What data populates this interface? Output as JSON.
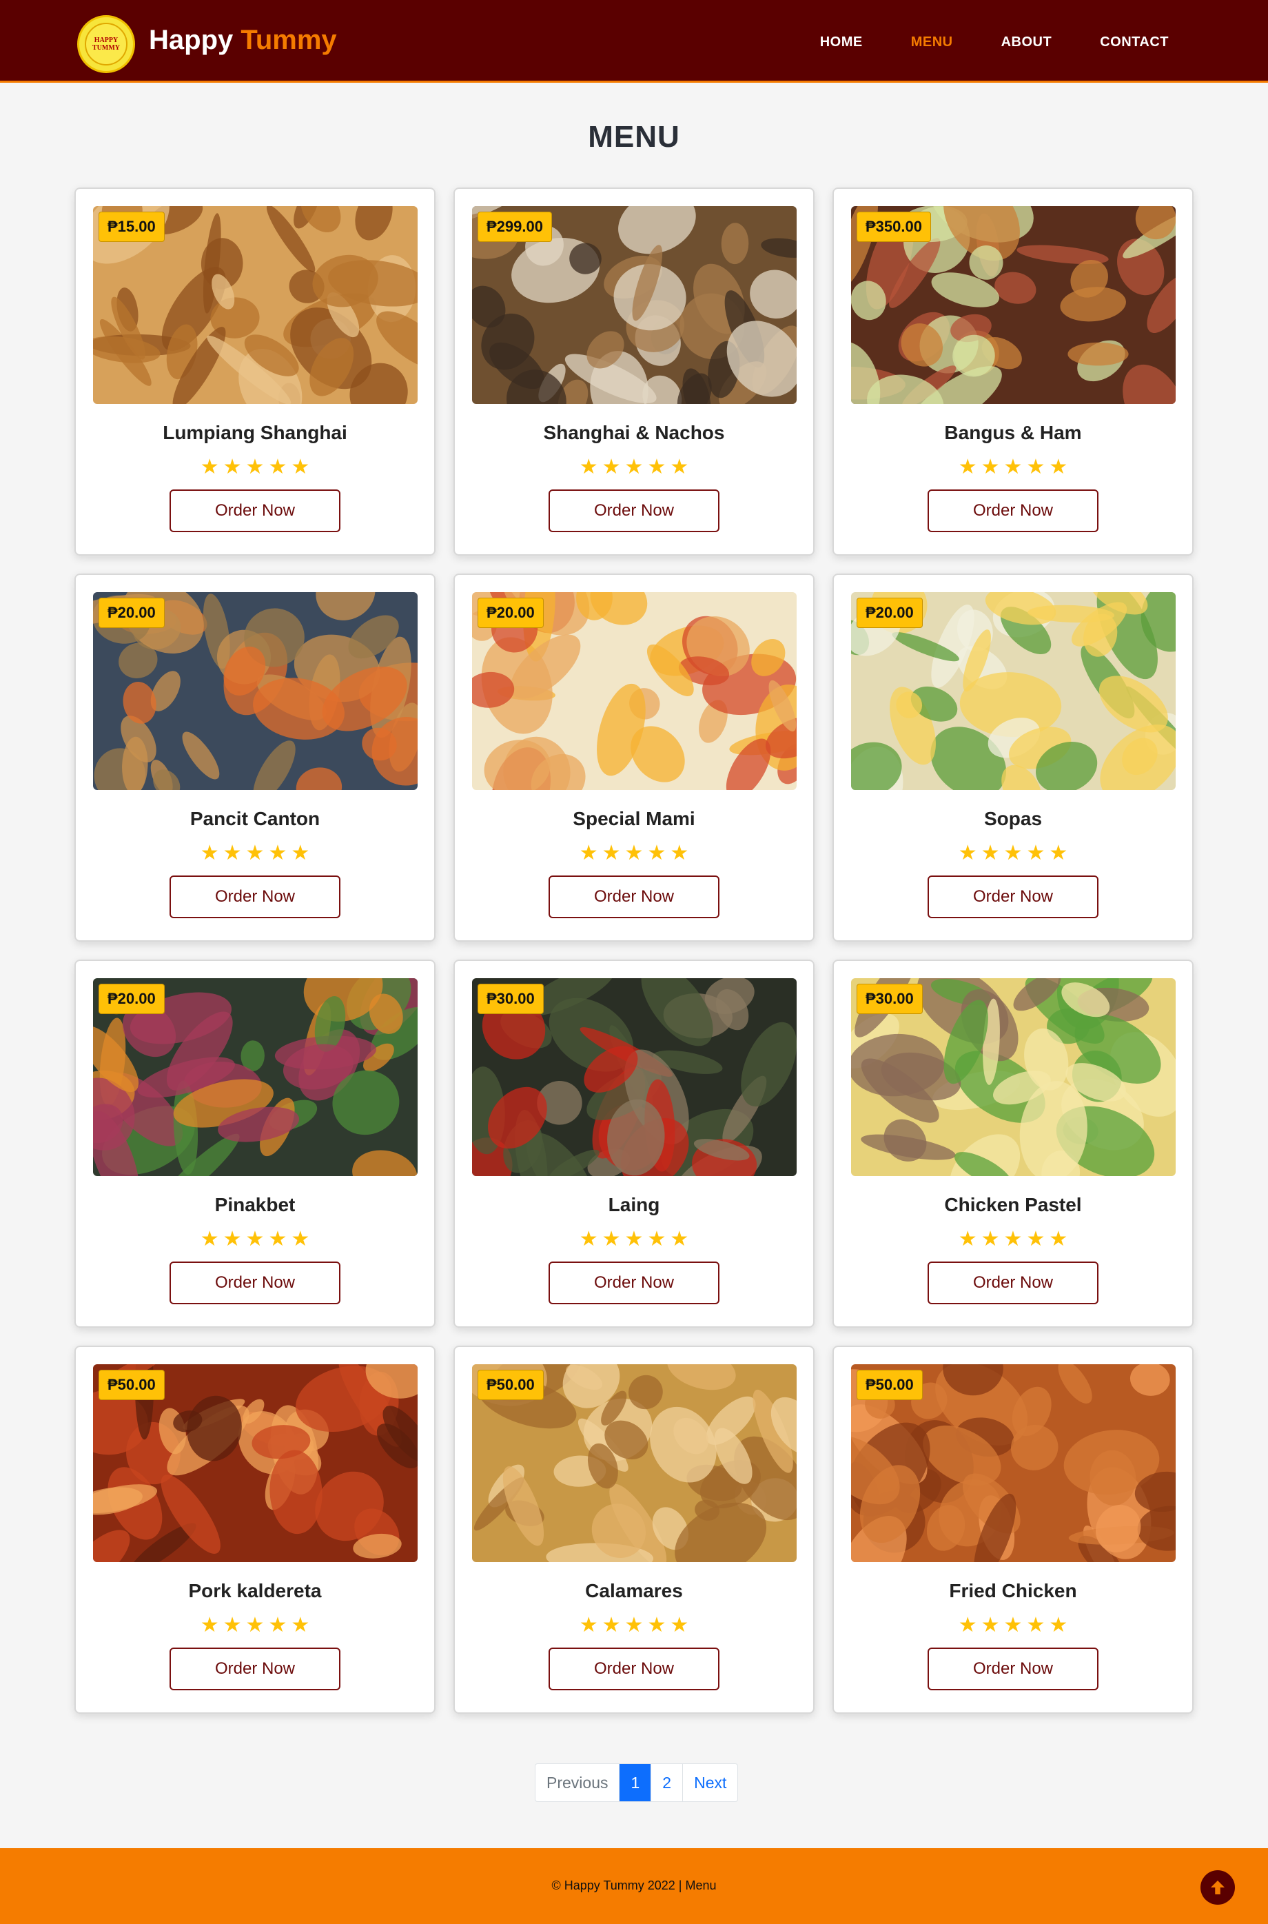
{
  "header": {
    "logo_text_top": "HAPPY",
    "logo_text_bottom": "TUMMY",
    "brand_first": "Happy",
    "brand_second": "Tummy",
    "nav": [
      {
        "label": "HOME"
      },
      {
        "label": "MENU"
      },
      {
        "label": "ABOUT"
      },
      {
        "label": "CONTACT"
      }
    ]
  },
  "main": {
    "title": "MENU",
    "items": [
      {
        "price": "₱15.00",
        "name": "Lumpiang Shanghai",
        "rating": 5,
        "button": "Order Now"
      },
      {
        "price": "₱299.00",
        "name": "Shanghai & Nachos",
        "rating": 5,
        "button": "Order Now"
      },
      {
        "price": "₱350.00",
        "name": "Bangus & Ham",
        "rating": 5,
        "button": "Order Now"
      },
      {
        "price": "₱20.00",
        "name": "Pancit Canton",
        "rating": 5,
        "button": "Order Now"
      },
      {
        "price": "₱20.00",
        "name": "Special Mami",
        "rating": 5,
        "button": "Order Now"
      },
      {
        "price": "₱20.00",
        "name": "Sopas",
        "rating": 5,
        "button": "Order Now"
      },
      {
        "price": "₱20.00",
        "name": "Pinakbet",
        "rating": 5,
        "button": "Order Now"
      },
      {
        "price": "₱30.00",
        "name": "Laing",
        "rating": 5,
        "button": "Order Now"
      },
      {
        "price": "₱30.00",
        "name": "Chicken Pastel",
        "rating": 5,
        "button": "Order Now"
      },
      {
        "price": "₱50.00",
        "name": "Pork kaldereta",
        "rating": 5,
        "button": "Order Now"
      },
      {
        "price": "₱50.00",
        "name": "Calamares",
        "rating": 5,
        "button": "Order Now"
      },
      {
        "price": "₱50.00",
        "name": "Fried Chicken",
        "rating": 5,
        "button": "Order Now"
      }
    ]
  },
  "pagination": {
    "previous": "Previous",
    "pages": [
      "1",
      "2"
    ],
    "next": "Next"
  },
  "footer": {
    "text": "© Happy Tummy 2022 | Menu"
  },
  "colors": {
    "navbar": "#5a0000",
    "accent": "#f57c00",
    "price_badge": "#ffc107",
    "star": "#ffc107",
    "page_active": "#0d6efd"
  }
}
